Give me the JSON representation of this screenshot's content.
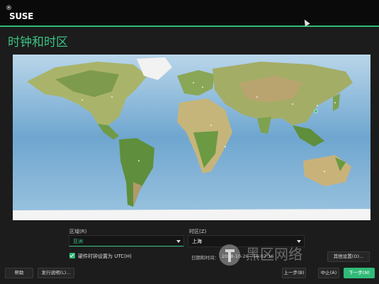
{
  "header": {
    "logo_text": "SUSE",
    "logo_mark": "®"
  },
  "page": {
    "title": "时钟和时区"
  },
  "form": {
    "region_label": "区域(R)",
    "region_value": "亚洲",
    "timezone_label": "时区(Z)",
    "timezone_value": "上海",
    "utc_checkbox_label": "硬件时钟设置为 UTC(H)",
    "utc_checked": true,
    "datetime_label": "日期和时间：",
    "datetime_value": "2018-10-20 - 16:07:16",
    "other_settings_label": "其他设置(O)..."
  },
  "footer": {
    "help_label": "帮助",
    "release_notes_label": "发行说明(L)...",
    "back_label": "上一步(B)",
    "abort_label": "中止(A)",
    "next_label": "下一步(N)"
  },
  "watermark": {
    "text": "黑区网络"
  },
  "colors": {
    "accent": "#30ba78",
    "background": "#1c1c1c",
    "topbar": "#0a0a0a"
  }
}
